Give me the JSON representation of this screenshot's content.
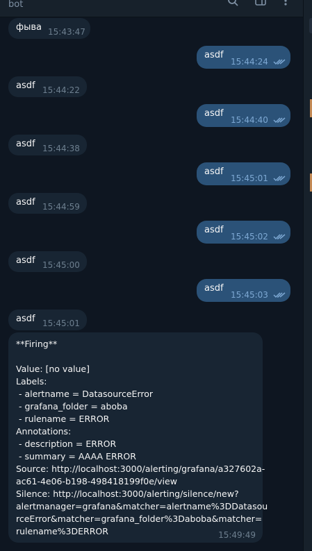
{
  "header": {
    "title": "bot"
  },
  "messages": [
    {
      "dir": "in",
      "text": "фыва",
      "time": "15:43:47"
    },
    {
      "dir": "out",
      "text": "asdf",
      "time": "15:44:24"
    },
    {
      "dir": "in",
      "text": "asdf",
      "time": "15:44:22"
    },
    {
      "dir": "out",
      "text": "asdf",
      "time": "15:44:40"
    },
    {
      "dir": "in",
      "text": "asdf",
      "time": "15:44:38"
    },
    {
      "dir": "out",
      "text": "asdf",
      "time": "15:45:01"
    },
    {
      "dir": "in",
      "text": "asdf",
      "time": "15:44:59"
    },
    {
      "dir": "out",
      "text": "asdf",
      "time": "15:45:02"
    },
    {
      "dir": "in",
      "text": "asdf",
      "time": "15:45:00"
    },
    {
      "dir": "out",
      "text": "asdf",
      "time": "15:45:03"
    },
    {
      "dir": "in",
      "text": "asdf",
      "time": "15:45:01"
    }
  ],
  "alert": {
    "time": "15:49:49",
    "lines": [
      "**Firing**",
      "",
      "Value: [no value]",
      "Labels:",
      " - alertname = DatasourceError",
      " - grafana_folder = aboba",
      " - rulename = ERROR",
      "Annotations:",
      " - description = ERROR",
      " - summary = AAAA ERROR",
      "Source: http://localhost:3000/alerting/grafana/a327602a-",
      "ac61-4e06-b198-498418199f0e/view",
      "Silence: http://localhost:3000/alerting/silence/new?",
      "alertmanager=grafana&matcher=alertname%3DDatasou",
      "rceError&matcher=grafana_folder%3Daboba&matcher=",
      "rulename%3DERROR"
    ]
  },
  "icons": [
    "search-icon",
    "columns-icon",
    "more-icon",
    "double-check-icon"
  ],
  "colors": {
    "bg": "#0e1621",
    "incoming": "#182533",
    "outgoing": "#2b5278",
    "check": "#7da8d3"
  }
}
